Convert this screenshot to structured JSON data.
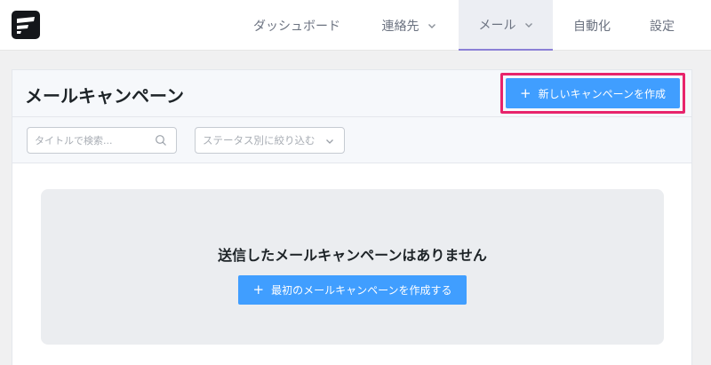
{
  "nav": {
    "items": [
      {
        "label": "ダッシュボード",
        "has_dropdown": false
      },
      {
        "label": "連絡先",
        "has_dropdown": true
      },
      {
        "label": "メール",
        "has_dropdown": true,
        "active": true
      },
      {
        "label": "自動化",
        "has_dropdown": false
      },
      {
        "label": "設定",
        "has_dropdown": false
      }
    ]
  },
  "page": {
    "title": "メールキャンペーン",
    "new_campaign_button": "新しいキャンペーンを作成"
  },
  "filters": {
    "search_placeholder": "タイトルで検索...",
    "status_placeholder": "ステータス別に絞り込む"
  },
  "empty_state": {
    "message": "送信したメールキャンペーンはありません",
    "create_first_button": "最初のメールキャンペーンを作成する"
  },
  "colors": {
    "primary": "#409eff",
    "highlight": "#e8246b",
    "active_nav_underline": "#8b7fd6"
  },
  "icons": {
    "logo": "app-logo",
    "search": "search-icon",
    "dropdown": "chevron-down-icon",
    "add": "plus-icon"
  }
}
